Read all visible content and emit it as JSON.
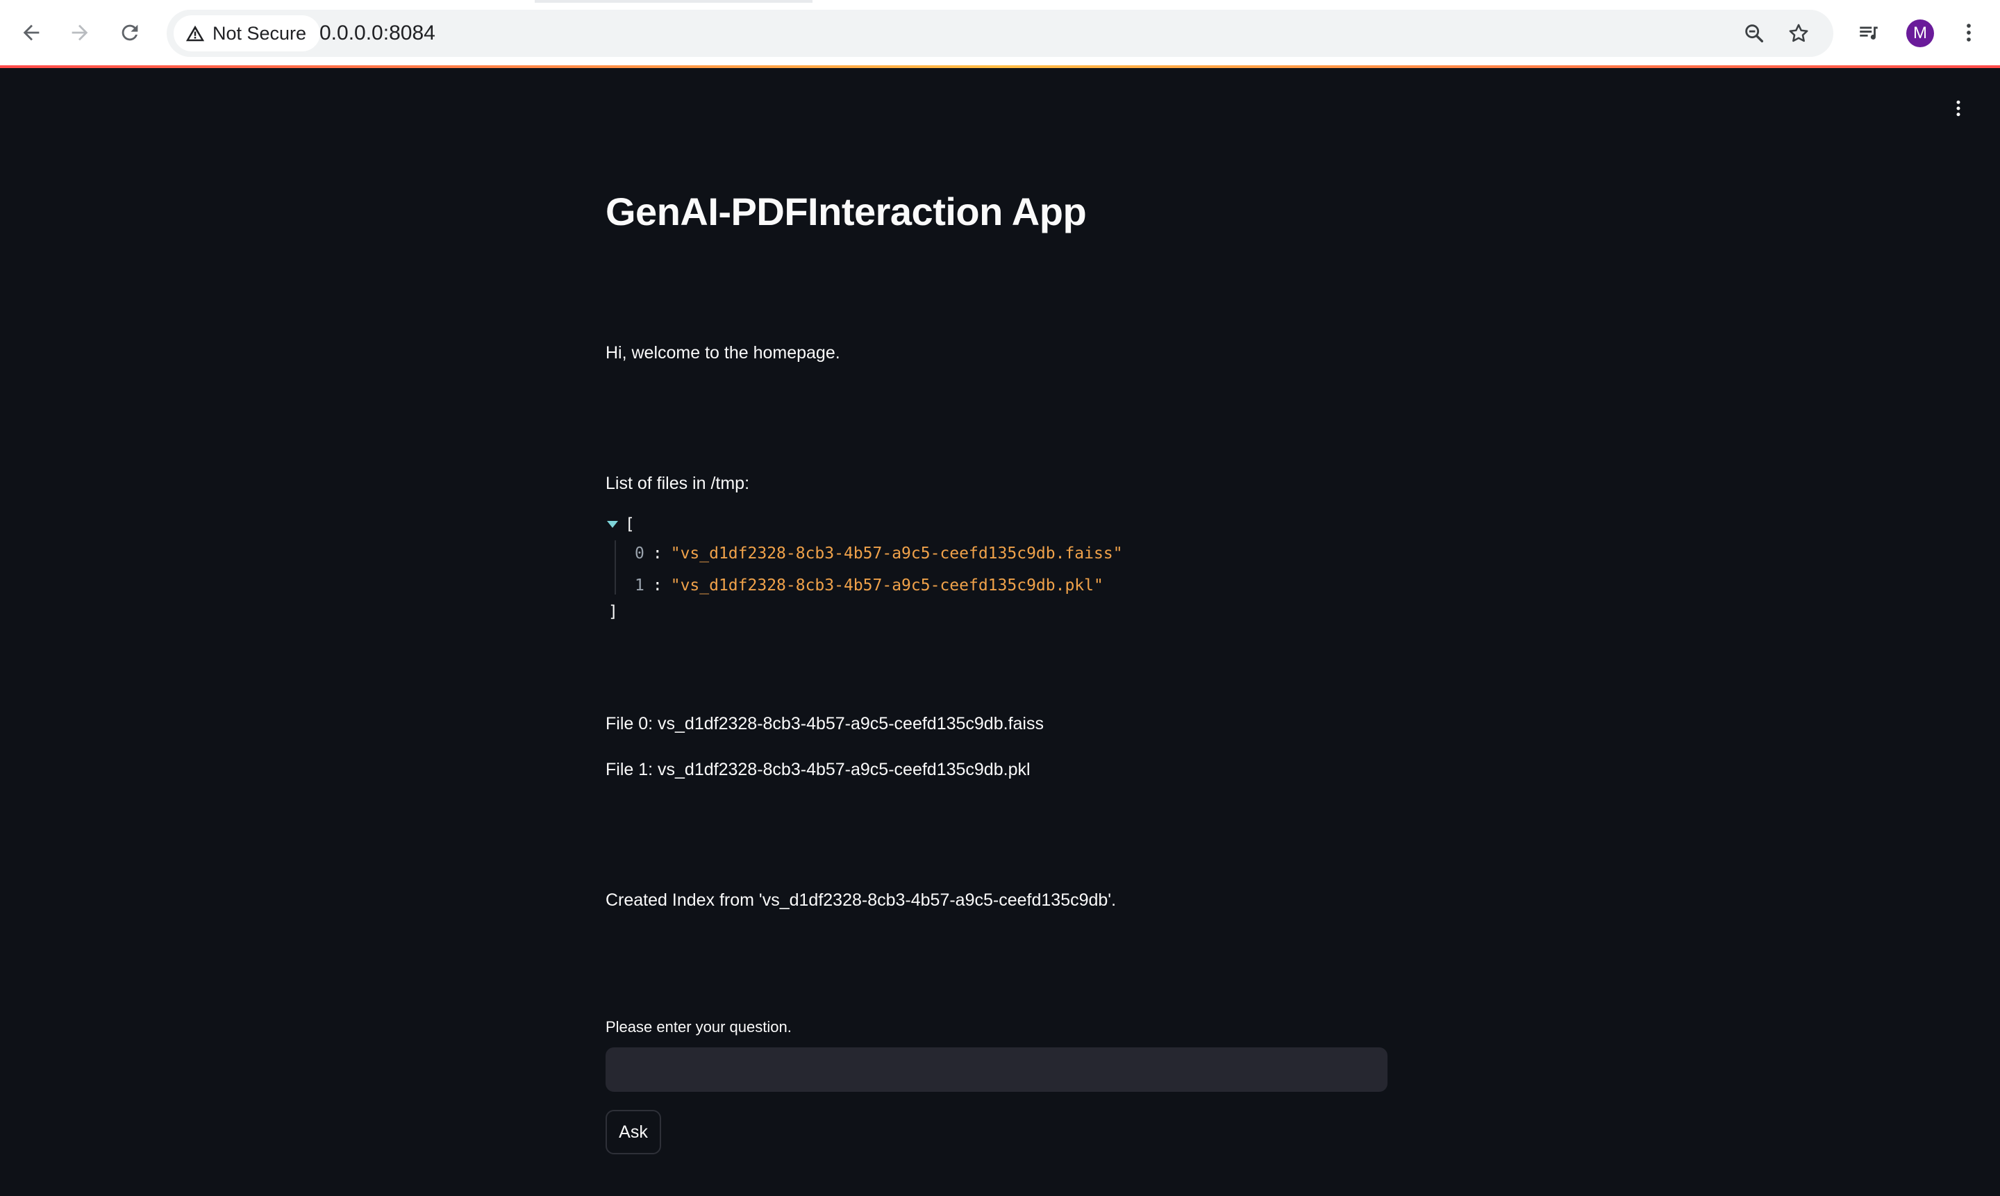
{
  "browser": {
    "security_label": "Not Secure",
    "url": "0.0.0.0:8084",
    "profile_initial": "M",
    "icons": {
      "back": "arrow-left-icon",
      "forward": "arrow-right-icon",
      "reload": "reload-icon",
      "security": "warning-triangle-icon",
      "zoom": "zoom-icon",
      "bookmark": "star-icon",
      "media": "media-queue-icon",
      "menu": "kebab-menu-icon"
    },
    "colors": {
      "chrome_bg": "#ffffff",
      "omnibox_bg": "#f1f3f4",
      "avatar_bg": "#6a1b9a"
    }
  },
  "app": {
    "title": "GenAI-PDFInteraction App",
    "welcome": "Hi, welcome to the homepage.",
    "files_heading": "List of files in /tmp:",
    "json_view": {
      "open_bracket": "[",
      "close_bracket": "]",
      "items": [
        {
          "index": "0",
          "value": "\"vs_d1df2328-8cb3-4b57-a9c5-ceefd135c9db.faiss\""
        },
        {
          "index": "1",
          "value": "\"vs_d1df2328-8cb3-4b57-a9c5-ceefd135c9db.pkl\""
        }
      ]
    },
    "file_lines": [
      "File 0: vs_d1df2328-8cb3-4b57-a9c5-ceefd135c9db.faiss",
      "File 1: vs_d1df2328-8cb3-4b57-a9c5-ceefd135c9db.pkl"
    ],
    "index_message": "Created Index from 'vs_d1df2328-8cb3-4b57-a9c5-ceefd135c9db'.",
    "question": {
      "label": "Please enter your question.",
      "value": "",
      "placeholder": ""
    },
    "ask_label": "Ask",
    "colors": {
      "background": "#0e1117",
      "text": "#fafafa",
      "input_bg": "#262730",
      "json_string": "#f0a24a",
      "accent": "#ff4b4b"
    }
  }
}
